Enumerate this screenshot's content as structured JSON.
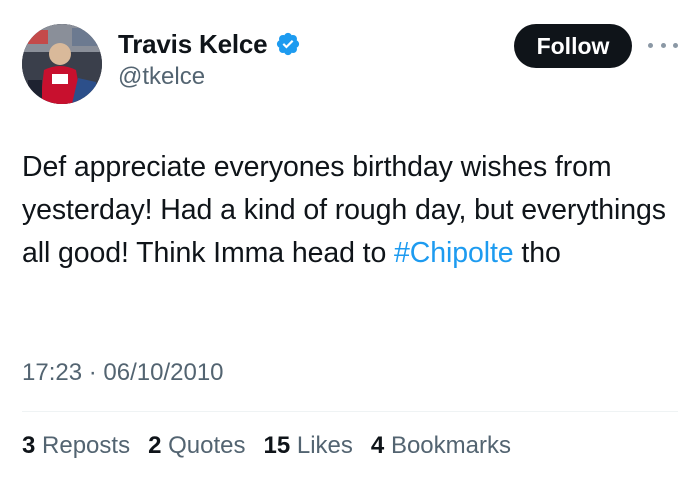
{
  "author": {
    "display_name": "Travis Kelce",
    "handle": "@tkelce",
    "verified": true
  },
  "follow_label": "Follow",
  "tweet": {
    "text_part1": "Def appreciate everyones birthday wishes from yesterday! Had a kind of rough day, but everythings all good! Think Imma head to ",
    "hashtag": "#Chipolte",
    "text_part2": " tho",
    "time": "17:23",
    "separator": " · ",
    "date": "06/10/2010"
  },
  "stats": [
    {
      "count": "3",
      "label": "Reposts"
    },
    {
      "count": "2",
      "label": "Quotes"
    },
    {
      "count": "15",
      "label": "Likes"
    },
    {
      "count": "4",
      "label": "Bookmarks"
    }
  ],
  "colors": {
    "accent": "#1d9bf0",
    "follow_bg": "#0f1419",
    "muted": "#536471"
  }
}
